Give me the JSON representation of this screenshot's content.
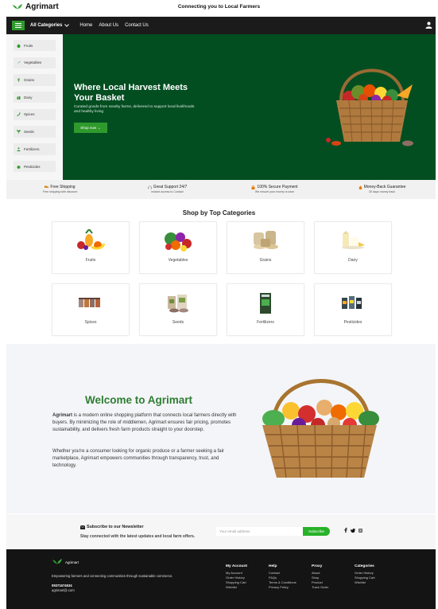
{
  "header": {
    "brand": "Agrimart",
    "tagline": "Connecting you to Local Farmers"
  },
  "nav": {
    "all_categories": "All Categories",
    "links": [
      "Home",
      "About Us",
      "Contact Us"
    ]
  },
  "sidebar": {
    "items": [
      {
        "label": "Fruits",
        "icon": "apple-icon"
      },
      {
        "label": "Vegetables",
        "icon": "carrot-icon"
      },
      {
        "label": "Grains",
        "icon": "wheat-icon"
      },
      {
        "label": "Dairy",
        "icon": "milk-icon"
      },
      {
        "label": "Spices",
        "icon": "pepper-icon"
      },
      {
        "label": "Seeds",
        "icon": "seedling-icon"
      },
      {
        "label": "Fertilizers",
        "icon": "person-icon"
      },
      {
        "label": "Pesticides",
        "icon": "bug-icon"
      }
    ]
  },
  "hero": {
    "title": "Where Local Harvest Meets Your Basket",
    "subtitle": "Curated goods from nearby farms, delivered to support local livelihoods and healthy living",
    "button": "Shop now →"
  },
  "features": [
    {
      "title": "Free Shipping",
      "sub": "Free shipping with discount",
      "icon": "truck-icon"
    },
    {
      "title": "Great Support 24/7",
      "sub": "Instant access to Contact",
      "icon": "headset-icon"
    },
    {
      "title": "100% Secure Payment",
      "sub": "We ensure your money is save",
      "icon": "lock-icon"
    },
    {
      "title": "Money-Back Guarantee",
      "sub": "30 days money back",
      "icon": "money-bag-icon"
    }
  ],
  "categories_section": {
    "title": "Shop by Top Categories",
    "items": [
      "Fruits",
      "Vegetables",
      "Grains",
      "Dairy",
      "Spices",
      "Seeds",
      "Fertilizers",
      "Pesticides"
    ]
  },
  "welcome": {
    "title": "Welcome to Agrimart",
    "p1_brand": "Agrimart",
    "p1_rest": " is a modern online shopping platform that connects local farmers directly with buyers. By minimizing the role of middlemen, Agrimart ensures fair pricing, promotes sustainability, and delivers fresh farm products straight to your doorstep.",
    "p2": "Whether you're a consumer looking for organic produce or a farmer seeking a fair marketplace, Agrimart empowers communities through transparency, trust, and technology."
  },
  "newsletter": {
    "title": "Subscribe to our Newsletter",
    "subtitle": "Stay connected with the latest updates and local farm offers.",
    "placeholder": "Your email address",
    "button": "Subscribe"
  },
  "footer": {
    "brand": "Agrimart",
    "description": "Empowering farmers and connecting communities through sustainable commerce.",
    "phone": "09371674634",
    "email": "agrimart@.com",
    "columns": [
      {
        "title": "My Account",
        "links": [
          "My Account",
          "Order History",
          "Shopping Cart",
          "Wishlist"
        ]
      },
      {
        "title": "Help",
        "links": [
          "Contact",
          "FAQs",
          "Terms & Conditions",
          "Privacy Policy"
        ]
      },
      {
        "title": "Proxy",
        "links": [
          "About",
          "Shop",
          "Product",
          "Track Order"
        ]
      },
      {
        "title": "Categories",
        "links": [
          "Order History",
          "Shopping Cart",
          "Wishlist"
        ]
      }
    ]
  },
  "colors": {
    "brand_green": "#2f9a2c",
    "hero_green": "#024e21",
    "nav_dark": "#1b1b1b",
    "welcome_green": "#2e7d32"
  }
}
